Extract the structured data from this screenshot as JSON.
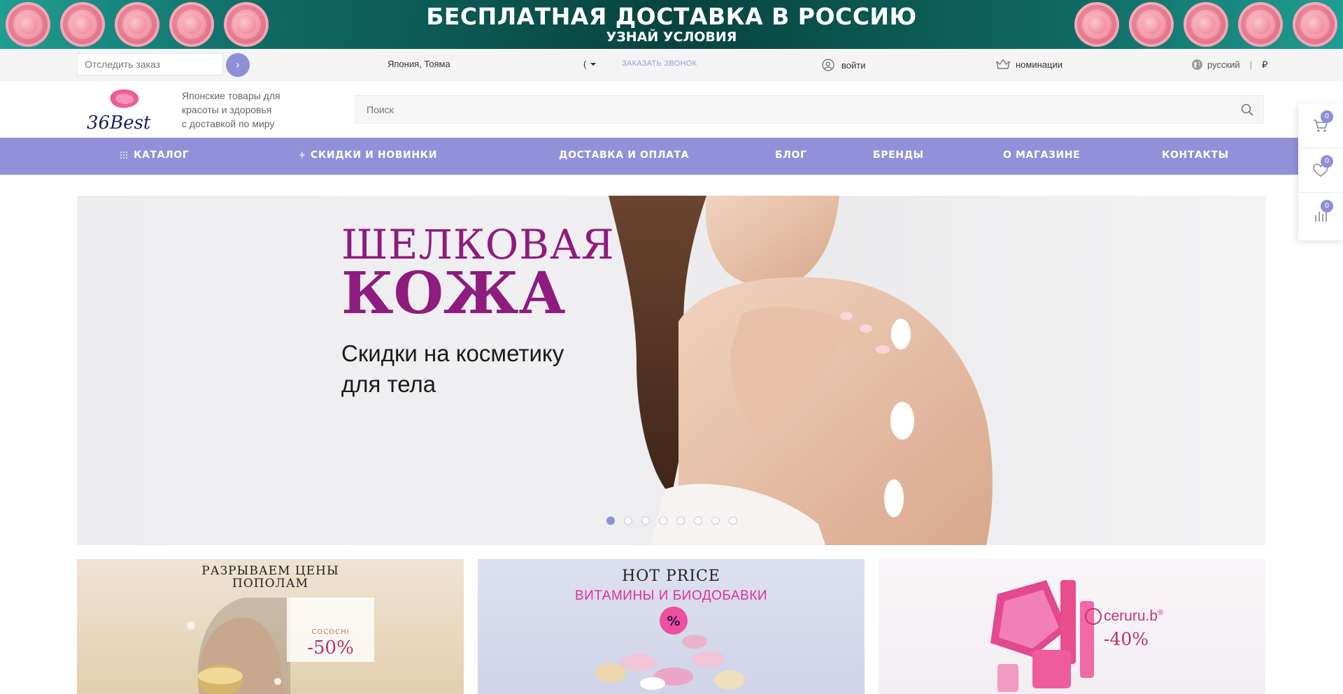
{
  "promo": {
    "title": "БЕСПЛАТНАЯ ДОСТАВКА В РОССИЮ",
    "subtitle": "УЗНАЙ УСЛОВИЯ"
  },
  "topbar": {
    "track_placeholder": "Отследить заказ",
    "track_button": "›",
    "location": "Япония, Тояма",
    "phone_icon": "(",
    "callback": "ЗАКАЗАТЬ ЗВОНОК",
    "login": "войти",
    "nominations": "номинации",
    "language": "русский",
    "currency": "₽"
  },
  "header": {
    "logo_text": "36Best",
    "tagline": [
      "Японские товары для",
      "красоты и здоровья",
      "с доставкой по миру"
    ],
    "search_placeholder": "Поиск"
  },
  "nav": {
    "items": [
      {
        "label": "КАТАЛОГ",
        "icon": "grid-icon"
      },
      {
        "label": "СКИДКИ И НОВИНКИ",
        "icon": "lightning-icon"
      },
      {
        "label": "ДОСТАВКА И ОПЛАТА"
      },
      {
        "label": "БЛОГ"
      },
      {
        "label": "БРЕНДЫ"
      },
      {
        "label": "О МАГАЗИНЕ"
      },
      {
        "label": "КОНТАКТЫ"
      }
    ]
  },
  "side_panel": {
    "cart_count": "0",
    "favorites_count": "0",
    "compare_count": "0"
  },
  "hero": {
    "line1": "ШЕЛКОВАЯ",
    "line2": "КОЖА",
    "line3a": "Скидки на косметику",
    "line3b": "для тела",
    "slides_total": 8,
    "active_slide": 1
  },
  "cards": [
    {
      "title_line1": "РАЗРЫВАЕМ ЦЕНЫ",
      "title_line2": "ПОПОЛАМ",
      "brand": "COCOCHI",
      "discount": "-50%"
    },
    {
      "title": "HOT PRICE",
      "subtitle": "ВИТАМИНЫ И БИОДОБАВКИ",
      "badge": "%"
    },
    {
      "brand": "ceruru.b",
      "brand_mark": "®",
      "discount": "-40%"
    }
  ],
  "colors": {
    "accent": "#9191d9",
    "promo_bg": "#0f6a63",
    "hero_title": "#8e1b7e",
    "card_pink": "#e0309a"
  }
}
